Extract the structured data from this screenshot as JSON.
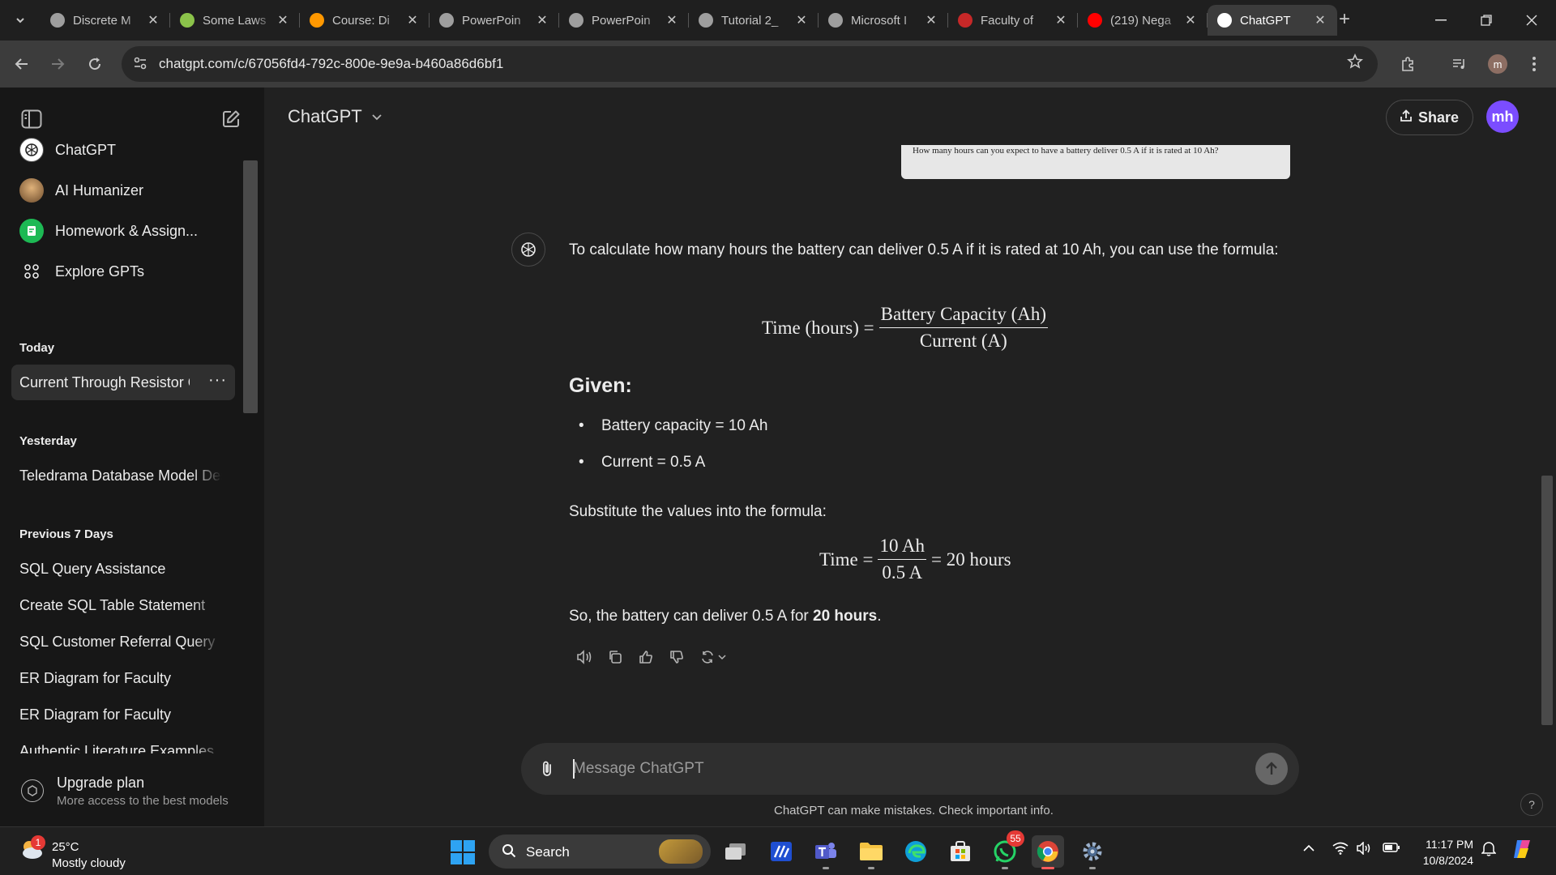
{
  "browser": {
    "tabs": [
      {
        "title": "Discrete M",
        "favicon_color": "#9e9e9e"
      },
      {
        "title": "Some Laws",
        "favicon_color": "#8bc34a"
      },
      {
        "title": "Course: Di",
        "favicon_color": "#ff9800"
      },
      {
        "title": "PowerPoin",
        "favicon_color": "#9e9e9e"
      },
      {
        "title": "PowerPoin",
        "favicon_color": "#9e9e9e"
      },
      {
        "title": "Tutorial 2_",
        "favicon_color": "#9e9e9e"
      },
      {
        "title": "Microsoft I",
        "favicon_color": "#9e9e9e"
      },
      {
        "title": "Faculty of",
        "favicon_color": "#c62828"
      },
      {
        "title": "(219) Nega",
        "favicon_color": "#ff0000"
      },
      {
        "title": "ChatGPT",
        "favicon_color": "#ffffff",
        "active": true
      }
    ],
    "url": "chatgpt.com/c/67056fd4-792c-800e-9e9a-b460a86d6bf1",
    "profile_initial": "m"
  },
  "sidebar": {
    "gpts": [
      {
        "label": "ChatGPT",
        "icon": "openai-icon"
      },
      {
        "label": "AI Humanizer",
        "icon": "humanizer-avatar"
      },
      {
        "label": "Homework & Assign...",
        "icon": "homework-icon"
      },
      {
        "label": "Explore GPTs",
        "icon": "grid-icon"
      }
    ],
    "sections": [
      {
        "heading": "Today",
        "items": [
          "Current Through Resistor Cal"
        ]
      },
      {
        "heading": "Yesterday",
        "items": [
          "Teledrama Database Model Desi"
        ]
      },
      {
        "heading": "Previous 7 Days",
        "items": [
          "SQL Query Assistance",
          "Create SQL Table Statement",
          "SQL Customer Referral Query",
          "ER Diagram for Faculty",
          "ER Diagram for Faculty",
          "Authentic Literature Examples"
        ]
      }
    ],
    "more_glyph": "···",
    "upgrade": {
      "title": "Upgrade plan",
      "subtitle": "More access to the best models"
    }
  },
  "header": {
    "model": "ChatGPT",
    "share_label": "Share",
    "user_initials": "mh"
  },
  "conversation": {
    "user_image_text": "How many hours can you expect to have a battery deliver 0.5 A if it is rated at 10 Ah?",
    "intro": "To calculate how many hours the battery can deliver 0.5 A if it is rated at 10 Ah, you can use the formula:",
    "formula": {
      "lhs": "Time (hours) =",
      "num": "Battery Capacity (Ah)",
      "den": "Current (A)"
    },
    "given_heading": "Given:",
    "given": [
      "Battery capacity = 10 Ah",
      "Current = 0.5 A"
    ],
    "substitute": "Substitute the values into the formula:",
    "calc": {
      "lhs": "Time =",
      "num": "10 Ah",
      "den": "0.5 A",
      "rhs": "= 20 hours"
    },
    "conclusion_prefix": "So, the battery can deliver 0.5 A for ",
    "conclusion_bold": "20 hours",
    "conclusion_suffix": "."
  },
  "composer": {
    "placeholder": "Message ChatGPT"
  },
  "disclaimer": "ChatGPT can make mistakes. Check important info.",
  "help_glyph": "?",
  "taskbar": {
    "weather": {
      "temp": "25°C",
      "desc": "Mostly cloudy",
      "badge": "1"
    },
    "search_label": "Search",
    "whatsapp_badge": "55",
    "time": "11:17 PM",
    "date": "10/8/2024"
  }
}
